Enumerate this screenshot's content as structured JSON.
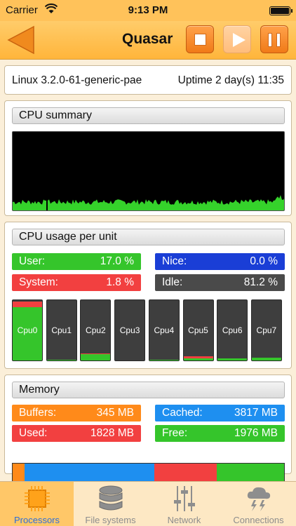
{
  "status_bar": {
    "carrier": "Carrier",
    "time": "9:13 PM"
  },
  "nav": {
    "title": "Quasar"
  },
  "sysinfo": {
    "kernel": "Linux 3.2.0-61-generic-pae",
    "uptime": "Uptime 2 day(s) 11:35"
  },
  "cpu_summary": {
    "title": "CPU summary"
  },
  "cpu_unit": {
    "title": "CPU usage per unit",
    "user_label": "User:",
    "user_value": "17.0 %",
    "nice_label": "Nice:",
    "nice_value": "0.0 %",
    "system_label": "System:",
    "system_value": "1.8 %",
    "idle_label": "Idle:",
    "idle_value": "81.2 %",
    "cores": [
      {
        "name": "Cpu0",
        "user": 0.88,
        "system": 0.1
      },
      {
        "name": "Cpu1",
        "user": 0.01,
        "system": 0.0
      },
      {
        "name": "Cpu2",
        "user": 0.1,
        "system": 0.02
      },
      {
        "name": "Cpu3",
        "user": 0.0,
        "system": 0.0
      },
      {
        "name": "Cpu4",
        "user": 0.01,
        "system": 0.0
      },
      {
        "name": "Cpu5",
        "user": 0.04,
        "system": 0.03
      },
      {
        "name": "Cpu6",
        "user": 0.04,
        "system": 0.0
      },
      {
        "name": "Cpu7",
        "user": 0.05,
        "system": 0.0
      }
    ]
  },
  "memory": {
    "title": "Memory",
    "buffers_label": "Buffers:",
    "buffers_value": "345 MB",
    "cached_label": "Cached:",
    "cached_value": "3817 MB",
    "used_label": "Used:",
    "used_value": "1828 MB",
    "free_label": "Free:",
    "free_value": "1976 MB",
    "bar": {
      "buffers": 345,
      "cached": 3817,
      "used": 1828,
      "free": 1976
    }
  },
  "tabs": [
    {
      "label": "Processors",
      "icon": "processor-icon",
      "active": true
    },
    {
      "label": "File systems",
      "icon": "database-icon",
      "active": false
    },
    {
      "label": "Network",
      "icon": "network-sliders-icon",
      "active": false
    },
    {
      "label": "Connections",
      "icon": "storm-cloud-icon",
      "active": false
    }
  ],
  "colors": {
    "user": "#35c52b",
    "nice": "#1a3ed6",
    "system": "#f24040",
    "idle": "#4a4a4a",
    "buffers": "#ff8a1a",
    "cached": "#1e8ff0",
    "used": "#f24040",
    "free": "#35c52b"
  }
}
